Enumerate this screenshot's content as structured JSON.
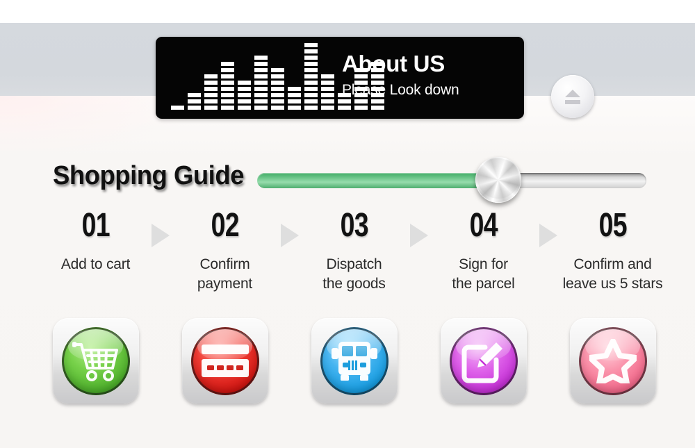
{
  "banner": {
    "title": "About US",
    "subtitle": "Please Look down",
    "equalizer": {
      "icon": "equalizer-icon",
      "bar_segments": [
        1,
        3,
        6,
        8,
        5,
        9,
        7,
        4,
        11,
        6,
        3,
        7,
        8
      ]
    }
  },
  "eject_button": {
    "icon": "eject-icon",
    "label": "Eject"
  },
  "guide": {
    "title": "Shopping Guide",
    "slider": {
      "icon": "slider-knob-icon",
      "value_percent": 62,
      "fill_color": "#6fc88c",
      "track_color": "#d8d8d8"
    }
  },
  "steps": [
    {
      "number": "01",
      "label": "Add to cart",
      "icon": "shopping-cart-icon",
      "color": "#4cae2a",
      "disc_class": "disc-green"
    },
    {
      "number": "02",
      "label": "Confirm\npayment",
      "label_line1": "Confirm",
      "label_line2": "payment",
      "icon": "credit-card-icon",
      "color": "#cf1410",
      "disc_class": "disc-red"
    },
    {
      "number": "03",
      "label": "Dispatch\nthe goods",
      "label_line1": "Dispatch",
      "label_line2": "the goods",
      "icon": "delivery-truck-icon",
      "color": "#179ce0",
      "disc_class": "disc-blue"
    },
    {
      "number": "04",
      "label": "Sign for\nthe parcel",
      "label_line1": "Sign for",
      "label_line2": "the parcel",
      "icon": "sign-document-pencil-icon",
      "color": "#c531d6",
      "disc_class": "disc-purple"
    },
    {
      "number": "05",
      "label": "Confirm and\nleave us 5 stars",
      "label_line1": "Confirm and",
      "label_line2": "leave us 5 stars",
      "icon": "star-icon",
      "color": "#f2688a",
      "disc_class": "disc-pink"
    }
  ],
  "arrows": {
    "icon": "triangle-right-icon",
    "count": 4,
    "color": "#dedede"
  },
  "theme": {
    "banner_bg": "#050505",
    "band_gray": "#d5d9de",
    "page_bg": "#f7f5f3",
    "text_dark": "#121212"
  }
}
